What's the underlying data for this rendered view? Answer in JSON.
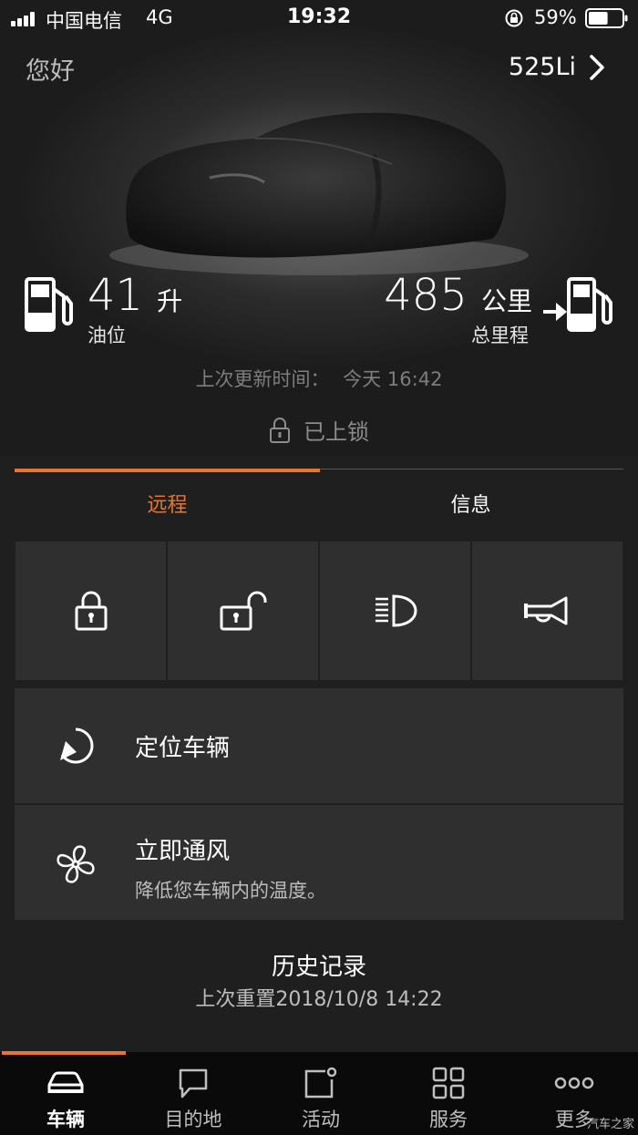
{
  "status_bar": {
    "carrier": "中国电信",
    "network": "4G",
    "time": "19:32",
    "battery": "59%",
    "battery_level": 0.59
  },
  "header": {
    "greeting": "您好",
    "model": "525Li"
  },
  "fuel": {
    "value": "41",
    "unit": "升",
    "label": "油位"
  },
  "range": {
    "value": "485",
    "unit": "公里",
    "label": "总里程"
  },
  "update": {
    "label": "上次更新时间：",
    "value": "今天 16:42"
  },
  "lock_status": "已上锁",
  "tabs": [
    {
      "label": "远程",
      "active": true
    },
    {
      "label": "信息",
      "active": false
    }
  ],
  "remote_actions": [
    {
      "icon": "lock-icon"
    },
    {
      "icon": "unlock-icon"
    },
    {
      "icon": "headlight-icon"
    },
    {
      "icon": "horn-icon"
    }
  ],
  "rows": {
    "locate": {
      "title": "定位车辆",
      "icon": "locate-icon"
    },
    "ventilate": {
      "title": "立即通风",
      "subtitle": "降低您车辆内的温度。",
      "icon": "fan-icon"
    }
  },
  "history": {
    "title": "历史记录",
    "subtitle": "上次重置2018/10/8 14:22"
  },
  "bottom_nav": [
    {
      "label": "车辆",
      "icon": "car-icon",
      "active": true
    },
    {
      "label": "目的地",
      "icon": "destination-icon",
      "active": false
    },
    {
      "label": "活动",
      "icon": "activity-icon",
      "active": false
    },
    {
      "label": "服务",
      "icon": "services-icon",
      "active": false
    },
    {
      "label": "更多",
      "icon": "more-icon",
      "active": false
    }
  ],
  "watermark": "汽车之家",
  "colors": {
    "accent": "#e8762b",
    "background": "#222222",
    "tile": "#2f2f2f"
  }
}
